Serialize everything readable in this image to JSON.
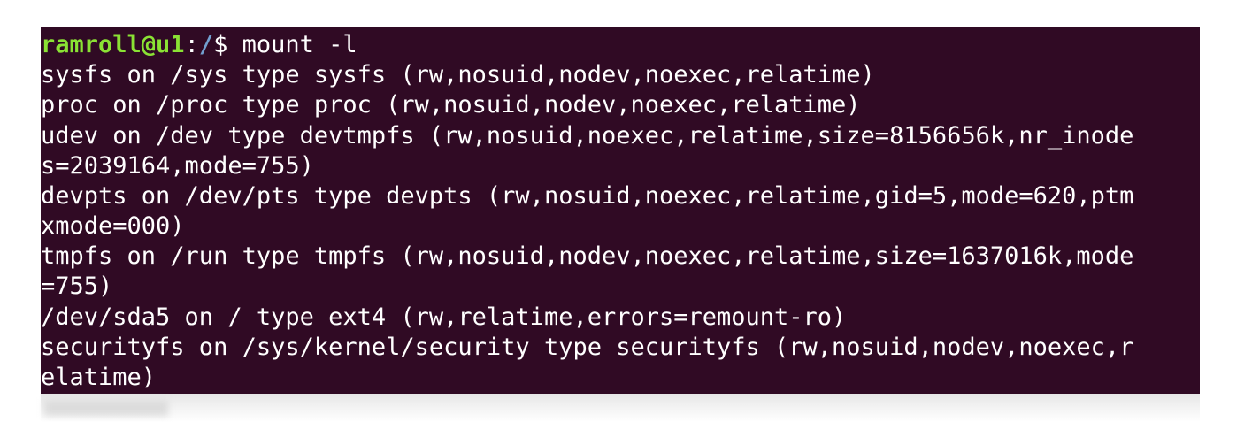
{
  "prompt": {
    "user_host": "ramroll@u1",
    "separator": ":",
    "path": "/",
    "symbol": "$ ",
    "command": "mount -l"
  },
  "output_lines": [
    "sysfs on /sys type sysfs (rw,nosuid,nodev,noexec,relatime)",
    "proc on /proc type proc (rw,nosuid,nodev,noexec,relatime)",
    "udev on /dev type devtmpfs (rw,nosuid,noexec,relatime,size=8156656k,nr_inode",
    "s=2039164,mode=755)",
    "devpts on /dev/pts type devpts (rw,nosuid,noexec,relatime,gid=5,mode=620,ptm",
    "xmode=000)",
    "tmpfs on /run type tmpfs (rw,nosuid,nodev,noexec,relatime,size=1637016k,mode",
    "=755)",
    "/dev/sda5 on / type ext4 (rw,relatime,errors=remount-ro)",
    "securityfs on /sys/kernel/security type securityfs (rw,nosuid,nodev,noexec,r",
    "elatime)"
  ],
  "colors": {
    "background": "#300a24",
    "text": "#ffffff",
    "prompt_user": "#8ae234",
    "prompt_path": "#729fcf"
  }
}
